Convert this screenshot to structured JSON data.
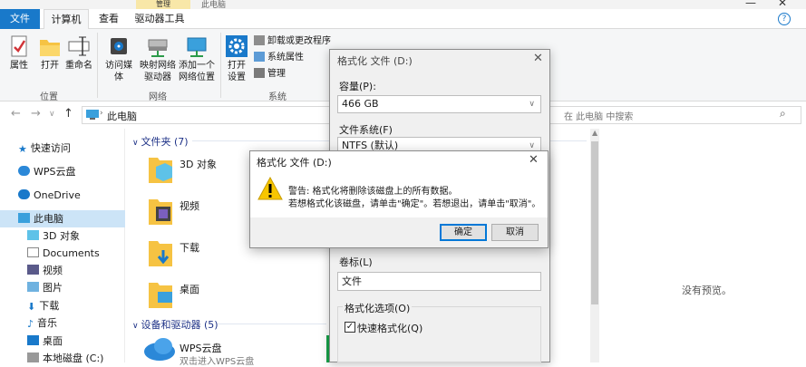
{
  "window": {
    "title": "此电脑",
    "manage_tab": "管理",
    "minimize": "—",
    "close": "✕"
  },
  "tabs": {
    "file": "文件",
    "computer": "计算机",
    "view": "查看",
    "drive_tools": "驱动器工具",
    "help": "?"
  },
  "ribbon": {
    "location_group": "位置",
    "network_group": "网络",
    "system_group": "系统",
    "properties": "属性",
    "open": "打开",
    "rename": "重命名",
    "access_media": "访问媒体",
    "map_drive_1": "映射网络",
    "map_drive_2": "驱动器",
    "add_network_1": "添加一个",
    "add_network_2": "网络位置",
    "open_settings_1": "打开",
    "open_settings_2": "设置",
    "uninstall": "卸载或更改程序",
    "system_properties": "系统属性",
    "manage": "管理"
  },
  "nav": {
    "address": "此电脑",
    "search_placeholder": "在 此电脑 中搜索"
  },
  "sidebar": {
    "items": [
      {
        "label": "快速访问"
      },
      {
        "label": "WPS云盘"
      },
      {
        "label": "OneDrive"
      },
      {
        "label": "此电脑"
      },
      {
        "label": "3D 对象"
      },
      {
        "label": "Documents"
      },
      {
        "label": "视频"
      },
      {
        "label": "图片"
      },
      {
        "label": "下载"
      },
      {
        "label": "音乐"
      },
      {
        "label": "桌面"
      },
      {
        "label": "本地磁盘 (C:)"
      }
    ]
  },
  "content": {
    "folders_header": "文件夹 (7)",
    "folders": [
      {
        "label": "3D 对象"
      },
      {
        "label": "视频"
      },
      {
        "label": "下载"
      },
      {
        "label": "桌面"
      }
    ],
    "devices_header": "设备和驱动器 (5)",
    "wps_name": "WPS云盘",
    "wps_desc": "双击进入WPS云盘",
    "no_preview": "没有预览。"
  },
  "format_dialog": {
    "title": "格式化 文件 (D:)",
    "close": "✕",
    "capacity_label": "容量(P):",
    "capacity_value": "466 GB",
    "fs_label": "文件系统(F)",
    "fs_value": "NTFS (默认)",
    "volume_label": "卷标(L)",
    "volume_value": "文件",
    "options_label": "格式化选项(O)",
    "quick_format_label": "快速格式化(Q)",
    "quick_format_checked": true
  },
  "warning_dialog": {
    "title": "格式化 文件 (D:)",
    "close": "✕",
    "line1": "警告: 格式化将删除该磁盘上的所有数据。",
    "line2": "若想格式化该磁盘，请单击\"确定\"。若想退出，请单击\"取消\"。",
    "ok": "确定",
    "cancel": "取消"
  },
  "colors": {
    "accent": "#1979ca",
    "selection": "#cce4f7",
    "folder": "#f6c343",
    "header_text": "#1e3287"
  }
}
